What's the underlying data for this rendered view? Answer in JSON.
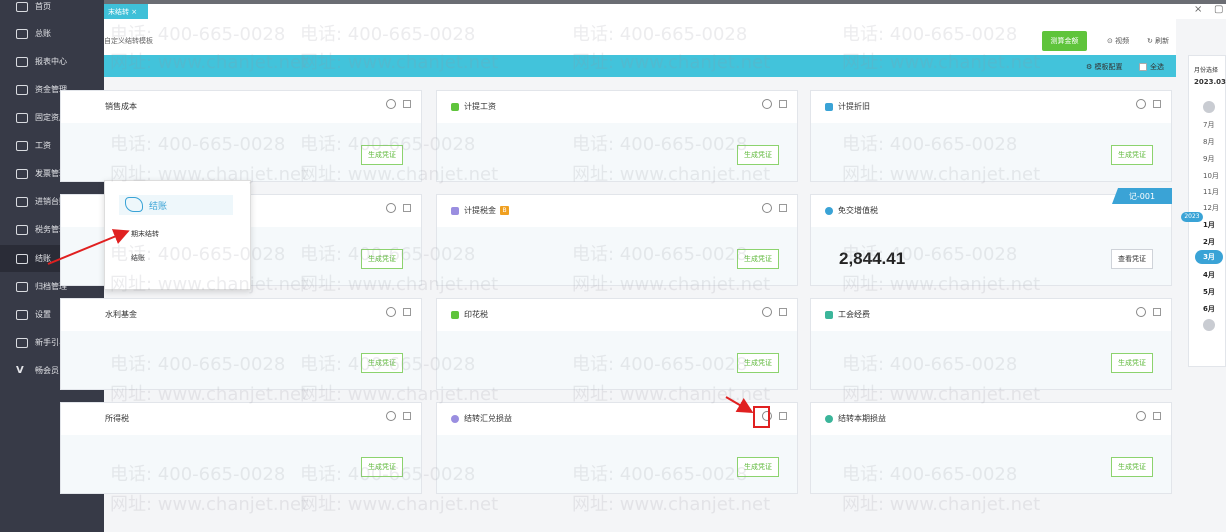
{
  "sidebar": {
    "items": [
      {
        "label": "首页",
        "icon": "home-icon"
      },
      {
        "label": "总账",
        "icon": "ledger-icon"
      },
      {
        "label": "报表中心",
        "icon": "report-icon"
      },
      {
        "label": "资金管理",
        "icon": "fund-icon"
      },
      {
        "label": "固定资产",
        "icon": "asset-icon"
      },
      {
        "label": "工资",
        "icon": "salary-icon"
      },
      {
        "label": "发票管理",
        "icon": "invoice-icon"
      },
      {
        "label": "进销台账",
        "icon": "inventory-icon"
      },
      {
        "label": "税务管理",
        "icon": "tax-icon"
      },
      {
        "label": "结账",
        "icon": "checkout-icon"
      },
      {
        "label": "归档管理",
        "icon": "archive-icon"
      },
      {
        "label": "设置",
        "icon": "settings-icon"
      },
      {
        "label": "新手引导",
        "icon": "guide-icon"
      },
      {
        "label": "畅会员",
        "icon": "vip-icon"
      }
    ]
  },
  "tab": {
    "label": "末结转 ×"
  },
  "window": {
    "close": "×",
    "restore": "▢"
  },
  "toolbar": {
    "breadcrumb": "自定义结转模板",
    "primary_button": "测算金额",
    "video": "⊙ 视频",
    "refresh": "↻ 刷新"
  },
  "subbar": {
    "template_config": "⚙ 模板配置",
    "select_all": "全选"
  },
  "cards": [
    {
      "title": "销售成本",
      "button": "生成凭证"
    },
    {
      "title": "计提工资",
      "button": "生成凭证"
    },
    {
      "title": "计提折旧",
      "button": "生成凭证"
    },
    {
      "title": "",
      "button": "生成凭证"
    },
    {
      "title": "计提税金",
      "button": "生成凭证",
      "badge": "B"
    },
    {
      "title": "免交增值税",
      "button": "查看凭证",
      "amount": "2,844.41",
      "ribbon": "记-001"
    },
    {
      "title": "水利基金",
      "button": "生成凭证"
    },
    {
      "title": "印花税",
      "button": "生成凭证"
    },
    {
      "title": "工会经费",
      "button": "生成凭证"
    },
    {
      "title": "所得税",
      "button": "生成凭证"
    },
    {
      "title": "结转汇兑损益",
      "button": "生成凭证"
    },
    {
      "title": "结转本期损益",
      "button": "生成凭证"
    }
  ],
  "popup": {
    "title": "结账",
    "items": [
      "期末结转",
      "结账"
    ]
  },
  "month_panel": {
    "title": "月份选择",
    "year": "2023.03",
    "year_pill": "2023",
    "months": [
      "7月",
      "8月",
      "9月",
      "10月",
      "11月",
      "12月",
      "1月",
      "2月",
      "3月",
      "4月",
      "5月",
      "6月"
    ],
    "active": "3月"
  },
  "watermark": {
    "phone": "电话: 400-665-0028",
    "site": "网址: www.chanjet.net"
  },
  "colors": {
    "sidebar": "#373a47",
    "accent": "#42c3db",
    "green": "#5fc43b",
    "blue": "#3aa3d6",
    "alert": "#e02020"
  }
}
